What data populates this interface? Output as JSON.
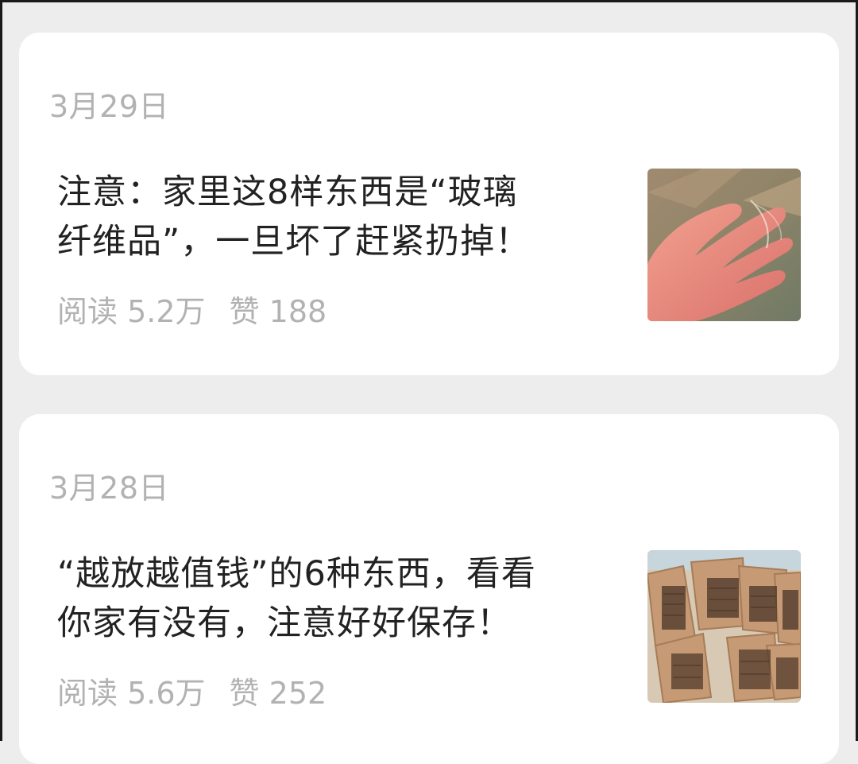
{
  "articles": [
    {
      "date": "3月29日",
      "title_line1": "注意：家里这8样东西是“玻璃",
      "title_line2": "纤维品”，一旦坏了赶紧扔掉！",
      "reads_label": "阅读",
      "reads_value": "5.2万",
      "likes_label": "赞",
      "likes_value": "188",
      "thumbnail_icon": "hand-photo"
    },
    {
      "date": "3月28日",
      "title_line1": "“越放越值钱”的6种东西，看看",
      "title_line2": "你家有没有，注意好好保存！",
      "reads_label": "阅读",
      "reads_value": "5.6万",
      "likes_label": "赞",
      "likes_value": "252",
      "thumbnail_icon": "paper-bags-photo"
    }
  ],
  "colors": {
    "background": "#ededed",
    "card": "#ffffff",
    "title_text": "#222222",
    "meta_text": "#b2b2b2"
  }
}
